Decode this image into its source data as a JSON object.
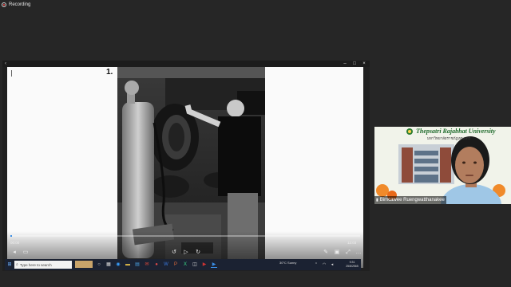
{
  "recording": {
    "label": "Recording"
  },
  "slide": {
    "page_number": "1."
  },
  "video": {
    "current_time": "00:00",
    "total_time": "12:03",
    "progress": 0.005
  },
  "taskbar": {
    "search_placeholder": "Type here to search",
    "weather": "30°C Sunny",
    "time": "9:31",
    "date": "25/8/2565"
  },
  "participant": {
    "university_name": "Thepsatri Rajabhat University",
    "university_subtitle": "มหาวิทยาลัยราชภัฏเทพสตรี",
    "display_name": "Bimcawee Ruengwatthanakee"
  },
  "colors": {
    "background": "#262626",
    "accent": "#3a8ee6",
    "taskbar": "#1b2232",
    "university_green": "#1f6b2c"
  }
}
